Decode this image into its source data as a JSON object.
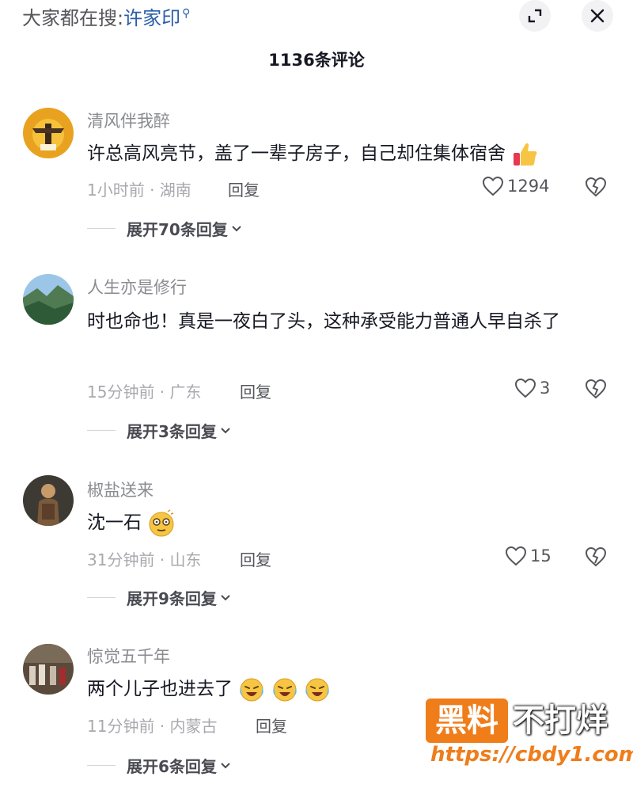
{
  "header": {
    "search_prefix": "大家都在搜:",
    "search_keyword": "许家印",
    "title": "1136条评论"
  },
  "comments": [
    {
      "user": "清风伴我醉",
      "text": "许总高风亮节，盖了一辈子房子，自己却住集体宿舍",
      "emoji": "thumbs-up",
      "time_location": "1小时前 · 湖南",
      "reply_label": "回复",
      "likes": "1294",
      "expand": "展开70条回复"
    },
    {
      "user": "人生亦是修行",
      "text": "时也命也！真是一夜白了头，这种承受能力普通人早自杀了",
      "time_location": "15分钟前 · 广东",
      "reply_label": "回复",
      "likes": "3",
      "expand": "展开3条回复"
    },
    {
      "user": "椒盐送来",
      "text": "沈一石",
      "emoji": "dizzy-face",
      "time_location": "31分钟前 · 山东",
      "reply_label": "回复",
      "likes": "15",
      "expand": "展开9条回复"
    },
    {
      "user": "惊觉五千年",
      "text": "两个儿子也进去了",
      "emoji": "crying-laughing x3",
      "time_location": "11分钟前 · 内蒙古",
      "reply_label": "回复",
      "expand": "展开6条回复"
    }
  ],
  "watermark": {
    "box": "黑料",
    "side": "不打烊",
    "url": "https://cbdy1.com"
  },
  "colors": {
    "accent_link": "#2a5ea8",
    "watermark_orange": "#ef7d1a"
  }
}
